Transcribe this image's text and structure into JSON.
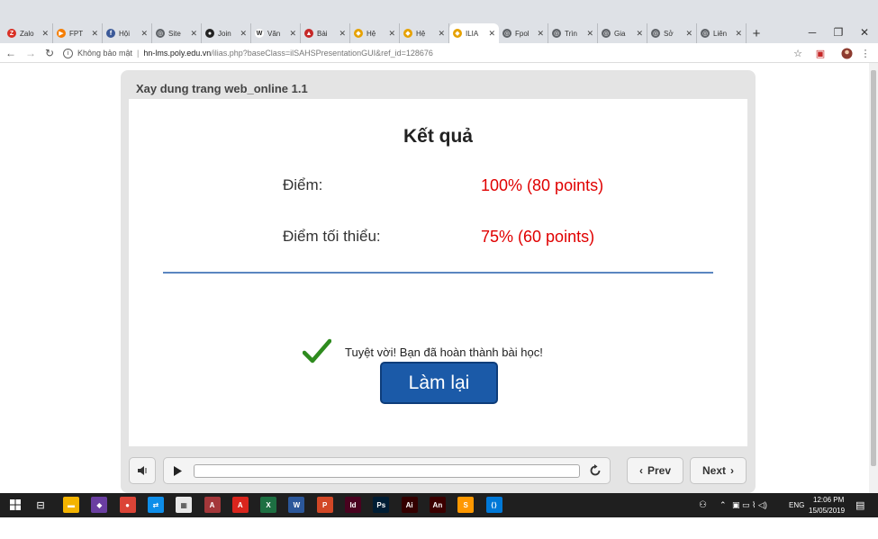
{
  "browser": {
    "tabs": [
      {
        "label": "Zalo",
        "icon_color": "#d93025",
        "glyph": "Z"
      },
      {
        "label": "FPT",
        "icon_color": "#f57c00",
        "glyph": "▶"
      },
      {
        "label": "Hội",
        "icon_color": "#3b5998",
        "glyph": "f"
      },
      {
        "label": "Site",
        "icon_color": "#5f6368",
        "glyph": "◎"
      },
      {
        "label": "Join",
        "icon_color": "#222222",
        "glyph": "●"
      },
      {
        "label": "Văn",
        "icon_color": "#ffffff",
        "glyph": "W"
      },
      {
        "label": "Bài",
        "icon_color": "#c62828",
        "glyph": "▲"
      },
      {
        "label": "Hệ",
        "icon_color": "#e6a100",
        "glyph": "◆"
      },
      {
        "label": "Hệ",
        "icon_color": "#e6a100",
        "glyph": "◆"
      },
      {
        "label": "ILIA",
        "icon_color": "#e6a100",
        "glyph": "◆"
      },
      {
        "label": "Fpol",
        "icon_color": "#5f6368",
        "glyph": "◎"
      },
      {
        "label": "Trìn",
        "icon_color": "#5f6368",
        "glyph": "◎"
      },
      {
        "label": "Gia",
        "icon_color": "#5f6368",
        "glyph": "◎"
      },
      {
        "label": "Sở",
        "icon_color": "#5f6368",
        "glyph": "◎"
      },
      {
        "label": "Liên",
        "icon_color": "#5f6368",
        "glyph": "◎"
      }
    ],
    "active_tab_index": 9,
    "new_tab_glyph": "+",
    "security_label": "Không bảo mật",
    "url_host": "hn-lms.poly.edu.vn",
    "url_path": "/ilias.php?baseClass=ilSAHSPresentationGUI&ref_id=128676"
  },
  "player": {
    "title": "Xay dung trang web_online 1.1",
    "heading": "Kết quả",
    "score_label": "Điểm:",
    "score_value": "100% (80 points)",
    "min_label": "Điểm tối thiểu:",
    "min_value": "75% (60 points)",
    "message": "Tuyệt vời! Bạn đã hoàn thành bài học!",
    "retry_label": "Làm lại",
    "prev_label": "Prev",
    "next_label": "Next"
  },
  "taskbar": {
    "apps": [
      {
        "name": "file-explorer",
        "color": "#f4b400",
        "glyph": "▬"
      },
      {
        "name": "visual-studio",
        "color": "#6a3ea1",
        "glyph": "◆"
      },
      {
        "name": "chrome",
        "color": "#db4437",
        "glyph": "●"
      },
      {
        "name": "teamviewer",
        "color": "#0e8ee9",
        "glyph": "⇄"
      },
      {
        "name": "app",
        "color": "#e8e8e8",
        "glyph": "▦"
      },
      {
        "name": "access",
        "color": "#a4373a",
        "glyph": "A"
      },
      {
        "name": "acrobat",
        "color": "#d9251d",
        "glyph": "A"
      },
      {
        "name": "excel",
        "color": "#1d6f42",
        "glyph": "X"
      },
      {
        "name": "word",
        "color": "#2b579a",
        "glyph": "W"
      },
      {
        "name": "powerpoint",
        "color": "#d24726",
        "glyph": "P"
      },
      {
        "name": "indesign",
        "color": "#49021f",
        "glyph": "Id"
      },
      {
        "name": "photoshop",
        "color": "#001d34",
        "glyph": "Ps"
      },
      {
        "name": "illustrator",
        "color": "#330000",
        "glyph": "Ai"
      },
      {
        "name": "animate",
        "color": "#3b0000",
        "glyph": "An"
      },
      {
        "name": "sublime",
        "color": "#ff9800",
        "glyph": "S"
      },
      {
        "name": "vscode",
        "color": "#0078d7",
        "glyph": "⟨⟩"
      }
    ],
    "language": "ENG",
    "time": "12:06 PM",
    "date": "15/05/2019"
  }
}
